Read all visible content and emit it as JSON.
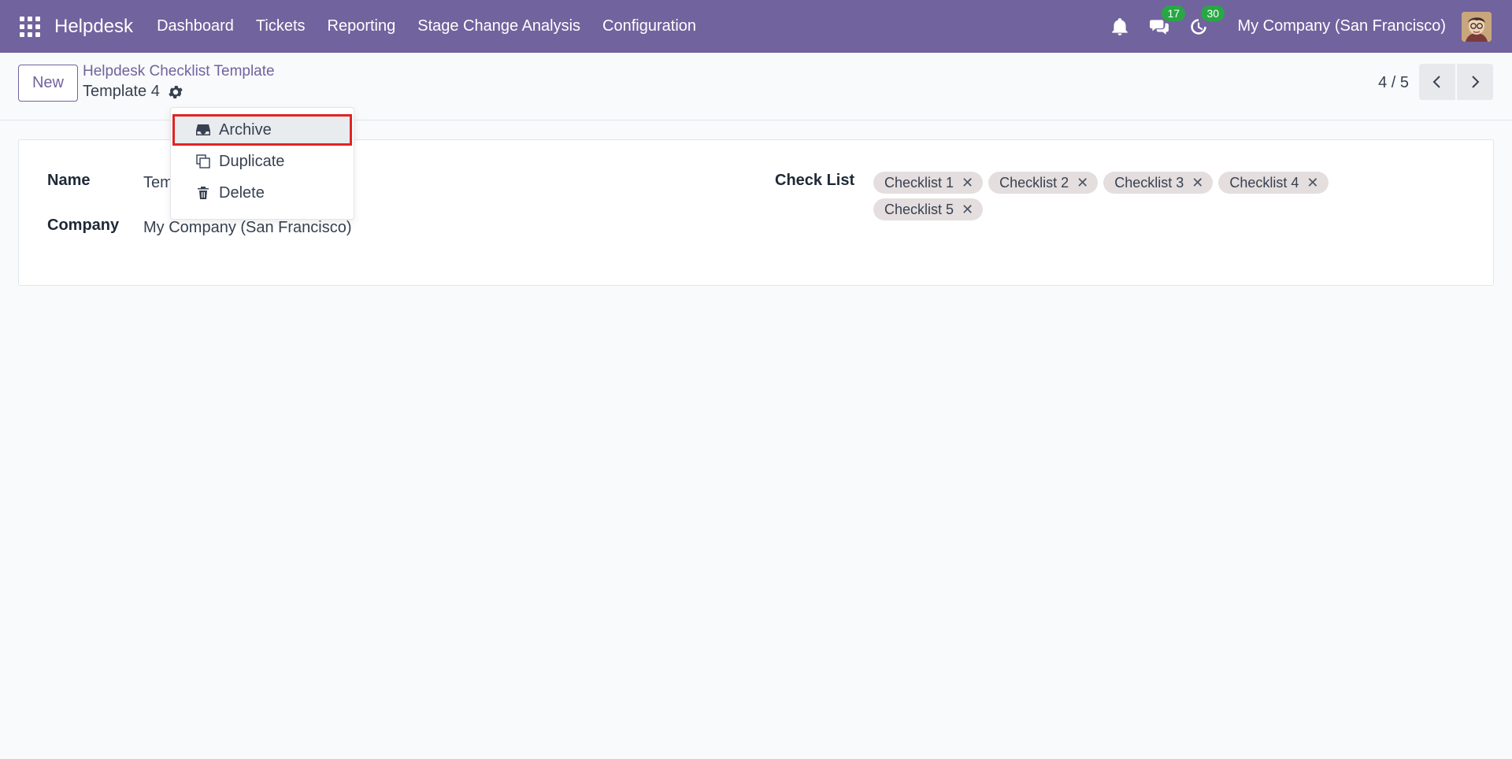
{
  "navbar": {
    "app_name": "Helpdesk",
    "menu": [
      {
        "label": "Dashboard"
      },
      {
        "label": "Tickets"
      },
      {
        "label": "Reporting"
      },
      {
        "label": "Stage Change Analysis"
      },
      {
        "label": "Configuration"
      }
    ],
    "messages_count": "17",
    "activities_count": "30",
    "company": "My Company (San Francisco)"
  },
  "control_panel": {
    "new_label": "New",
    "breadcrumb_parent": "Helpdesk Checklist Template",
    "record_title": "Template 4",
    "pager": "4 / 5"
  },
  "actions_menu": {
    "items": [
      {
        "label": "Archive",
        "icon": "archive-icon"
      },
      {
        "label": "Duplicate",
        "icon": "duplicate-icon"
      },
      {
        "label": "Delete",
        "icon": "trash-icon"
      }
    ]
  },
  "form": {
    "name_label": "Name",
    "name_value": "Tem",
    "company_label": "Company",
    "company_value": "My Company (San Francisco)",
    "checklist_label": "Check List",
    "checklist_tags": [
      {
        "label": "Checklist 1"
      },
      {
        "label": "Checklist 2"
      },
      {
        "label": "Checklist 3"
      },
      {
        "label": "Checklist 4"
      },
      {
        "label": "Checklist 5"
      }
    ],
    "tag_remove_glyph": "✕"
  },
  "colors": {
    "brand": "#71639e",
    "badge": "#28a745",
    "highlight": "#e02424"
  }
}
